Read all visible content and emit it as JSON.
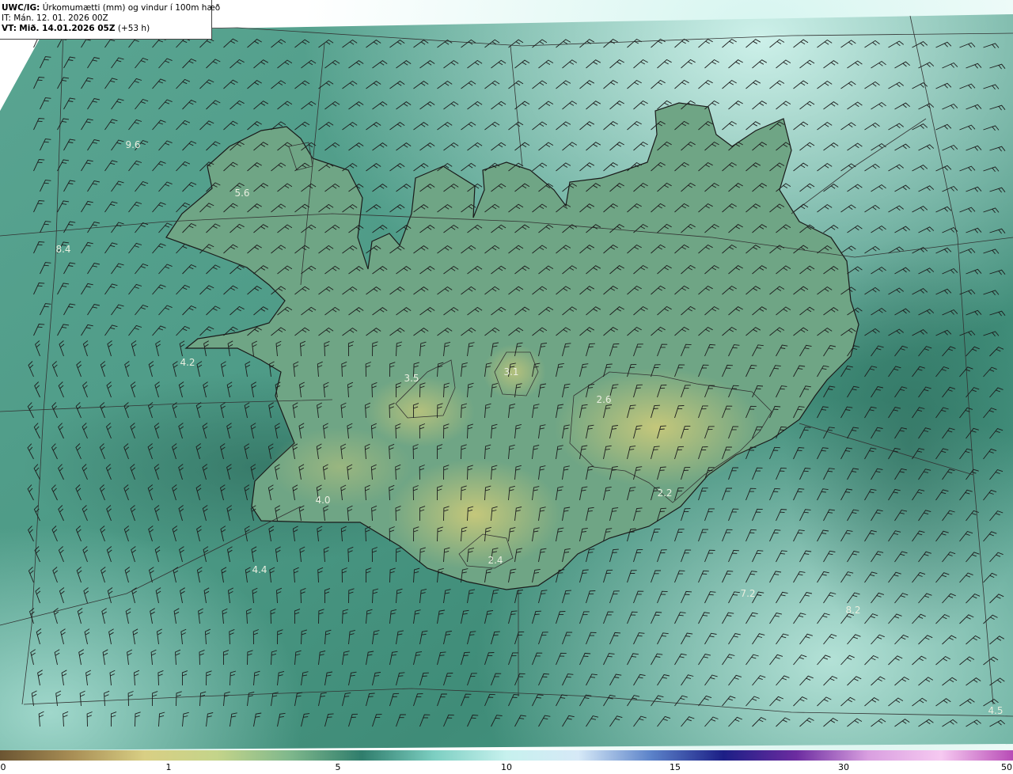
{
  "header": {
    "model": "UWC/IG:",
    "title": "Úrkomumætti (mm) og vindur í 100m hæð",
    "init_time": "IT: Mán. 12. 01. 2026 00Z",
    "valid_label": "VT:",
    "valid_time": "Mið. 14.01.2026 05Z",
    "lead": "(+53 h)"
  },
  "colors": {
    "coast": "#1a1a1a",
    "grid": "#333333",
    "barb": "#1c1c1c",
    "sea_low": "#3c8c78",
    "sea_high": "#bfeae0",
    "land_dry": "#c9c97a",
    "label_text": "#e9eedf"
  },
  "value_labels": [
    "9.6",
    "5.6",
    "8.4",
    "4.2",
    "3.5",
    "3.1",
    "2.6",
    "4.0",
    "4.4",
    "2.4",
    "2.2",
    "7.2",
    "8.2",
    "4.5"
  ],
  "colorbar": {
    "ticks": [
      "0",
      "1",
      "5",
      "10",
      "15",
      "30",
      "50"
    ],
    "stops": [
      "#6b5532",
      "#a88e55",
      "#d9cf84",
      "#c4d48a",
      "#7fb88c",
      "#2f7d6c",
      "#7dcfc2",
      "#c7f1ee",
      "#d6e9f7",
      "#5b82c9",
      "#1c1f86",
      "#6c2ca0",
      "#d99fe0",
      "#f6c9f1",
      "#b84cb6"
    ]
  }
}
